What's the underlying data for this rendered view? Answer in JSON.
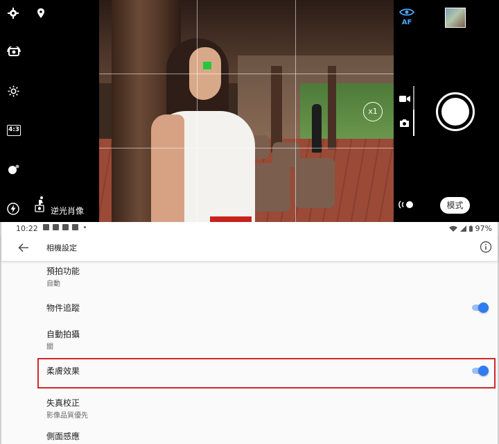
{
  "camera": {
    "mode_label": "逆光肖像",
    "af_label": "AF",
    "zoom_label": "x1",
    "mode_button_label": "模式",
    "icons": [
      "gear-icon",
      "location-pin-icon",
      "camera-switch-icon",
      "brightness-icon",
      "aspect-ratio-icon",
      "bokeh-icon",
      "flash-icon",
      "scene-person-icon",
      "eye-af-icon",
      "gallery-thumbnail",
      "video-mode-icon",
      "photo-mode-icon",
      "shutter-button",
      "remote-control-icon"
    ],
    "aspect_label": "4:3"
  },
  "statusbar": {
    "time": "10:22",
    "battery": "97%"
  },
  "settings": {
    "title": "相機設定",
    "items": [
      {
        "title": "預拍功能",
        "subtitle": "自動"
      },
      {
        "title": "物件追蹤",
        "toggle": true
      },
      {
        "title": "自動拍攝",
        "subtitle": "關"
      },
      {
        "title": "柔膚效果",
        "toggle": true,
        "highlighted": true
      },
      {
        "title": "失真校正",
        "subtitle": "影像品質優先"
      },
      {
        "title": "側面感應"
      }
    ]
  },
  "colors": {
    "accent": "#2f7cf2",
    "highlight": "#d2262a",
    "af_blue": "#4aa8ff",
    "focus_green": "#27c63b"
  }
}
